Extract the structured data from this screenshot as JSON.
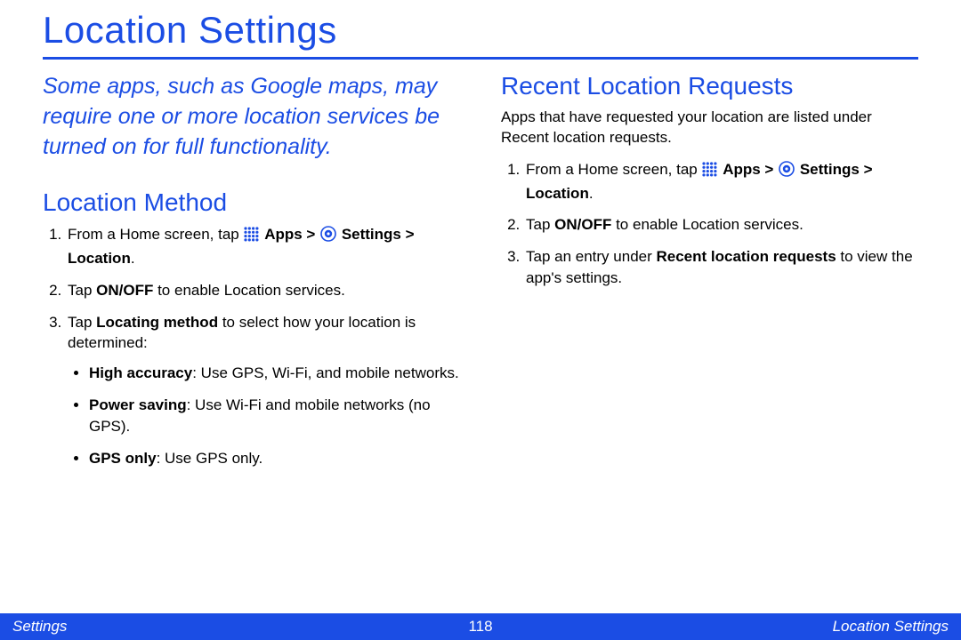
{
  "title": "Location Settings",
  "intro": "Some apps, such as Google maps, may require one or more location services be turned on for full functionality.",
  "left": {
    "heading": "Location Method",
    "step1_prefix": "From a Home screen, tap ",
    "apps_label": "Apps",
    "gt": " > ",
    "settings_label": "Settings",
    "location_label": "Location",
    "period": ".",
    "step2_a": "Tap ",
    "step2_b": "ON/OFF",
    "step2_c": " to enable Location services.",
    "step3_a": "Tap ",
    "step3_b": "Locating method",
    "step3_c": " to select how your location is determined:",
    "bullets": {
      "high_a": "High accuracy",
      "high_b": ": Use GPS, Wi-Fi, and mobile networks.",
      "power_a": "Power saving",
      "power_b": ": Use Wi-Fi and mobile networks (no GPS).",
      "gps_a": "GPS only",
      "gps_b": ": Use GPS only."
    }
  },
  "right": {
    "heading": "Recent Location Requests",
    "intro": "Apps that have requested your location are listed under Recent location requests.",
    "step1_prefix": "From a Home screen, tap ",
    "apps_label": "Apps",
    "gt": " > ",
    "settings_label": "Settings",
    "location_label": "Location",
    "period": ".",
    "step2_a": "Tap ",
    "step2_b": "ON/OFF",
    "step2_c": " to enable Location services.",
    "step3_a": "Tap an entry under ",
    "step3_b": "Recent location requests",
    "step3_c": " to view the app's settings."
  },
  "footer": {
    "left": "Settings",
    "center": "118",
    "right": "Location Settings"
  }
}
